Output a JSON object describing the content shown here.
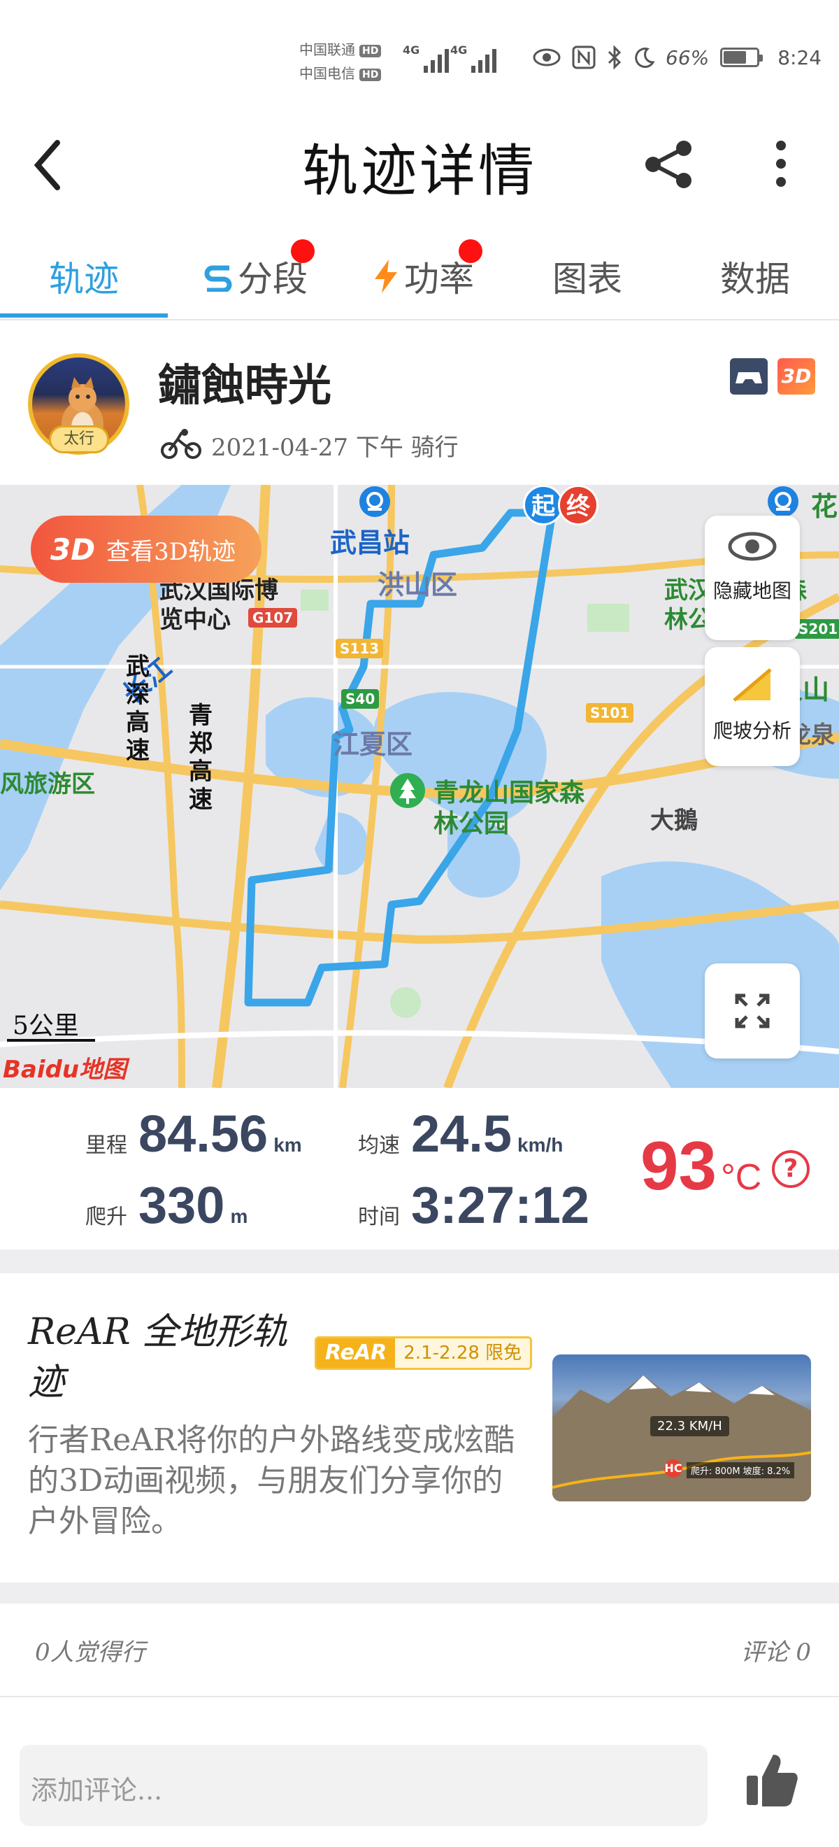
{
  "status_bar": {
    "carrier1": "中国联通",
    "carrier2": "中国电信",
    "hd": "HD",
    "net1": "4G",
    "net2": "4G",
    "battery_text": "66%",
    "battery_level": 0.66,
    "time": "8:24"
  },
  "header": {
    "title": "轨迹详情"
  },
  "tabs": [
    {
      "label": "轨迹",
      "active": true
    },
    {
      "label": "分段",
      "badge": true
    },
    {
      "label": "功率",
      "badge": true
    },
    {
      "label": "图表"
    },
    {
      "label": "数据"
    }
  ],
  "profile": {
    "name": "鏽蝕時光",
    "avatar_tag": "太行",
    "meta": "2021-04-27 下午 骑行",
    "badge_3d": "3D"
  },
  "map": {
    "view_3d_label": "查看3D轨迹",
    "view_3d_badge": "3D",
    "start_marker": "起",
    "end_marker": "终",
    "hide_map_label": "隐藏地图",
    "climb_label": "爬坡分析",
    "scale_label": "5公里",
    "brand": "Baidu地图",
    "places": {
      "wuchang_station": "武昌站",
      "hongshan": "洪山区",
      "expo_center": "武汉国际博览中心",
      "yangtze": "长江",
      "wuhan_forest_zoo": "武汉动物园森林公园",
      "longquanshan": "龙泉山",
      "longquan": "龙泉",
      "jiangxia": "江夏区",
      "wushen_expressway": "武深高速",
      "qingzheng_expressway": "青郑高速",
      "tourism_zone": "风旅游区",
      "qinglongshan": "青龙山国家森林公园",
      "dadun": "大鵝",
      "hua": "花"
    },
    "roads": [
      "G107",
      "S113",
      "S40",
      "S101",
      "S201"
    ]
  },
  "stats": {
    "distance_label": "里程",
    "distance_value": "84.56",
    "distance_unit": "km",
    "avg_speed_label": "均速",
    "avg_speed_value": "24.5",
    "avg_speed_unit": "km/h",
    "climb_label": "爬升",
    "climb_value": "330",
    "climb_unit": "m",
    "time_label": "时间",
    "time_value": "3:27:12",
    "temp_value": "93",
    "temp_unit": "°C",
    "help": "?"
  },
  "promo": {
    "title": "ReAR 全地形轨迹",
    "brand_badge": "ReAR",
    "date_badge": "2.1-2.28 限免",
    "description": "行者ReAR将你的户外路线变成炫酷的3D动画视频，与朋友们分享你的户外冒险。",
    "thumb_speed": "22.3 KM/H",
    "thumb_hc": "HC",
    "thumb_stats": "爬升: 800M 坡度: 8.2%"
  },
  "social": {
    "likes_text": "0人觉得行",
    "comments_text": "评论 0"
  },
  "comment": {
    "placeholder": "添加评论..."
  },
  "colors": {
    "accent": "#2ea0e0",
    "route": "#3aa5e8",
    "temp": "#e63946",
    "badge_red": "#ff1111"
  }
}
